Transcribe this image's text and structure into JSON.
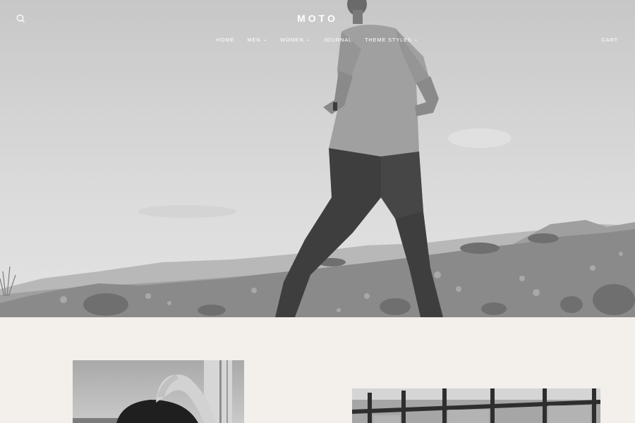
{
  "header": {
    "logo": "MOTO",
    "nav": [
      {
        "label": "HOME",
        "has_dropdown": false
      },
      {
        "label": "MEN",
        "has_dropdown": true
      },
      {
        "label": "WOMEN",
        "has_dropdown": true
      },
      {
        "label": "JOURNAL",
        "has_dropdown": false
      },
      {
        "label": "THEME STYLES",
        "has_dropdown": true
      }
    ],
    "cart_label": "CART",
    "search_icon": "search-icon",
    "dropdown_icon": "chevron-down-icon"
  },
  "hero": {
    "image": "man-walking-on-rocky-hill-black-and-white"
  },
  "featured": {
    "left_image": "woman-hand-in-hair-black-and-white",
    "right_image": "glass-building-facade-black-and-white"
  },
  "colors": {
    "background": "#f3efeb",
    "header_text": "#ffffff"
  }
}
